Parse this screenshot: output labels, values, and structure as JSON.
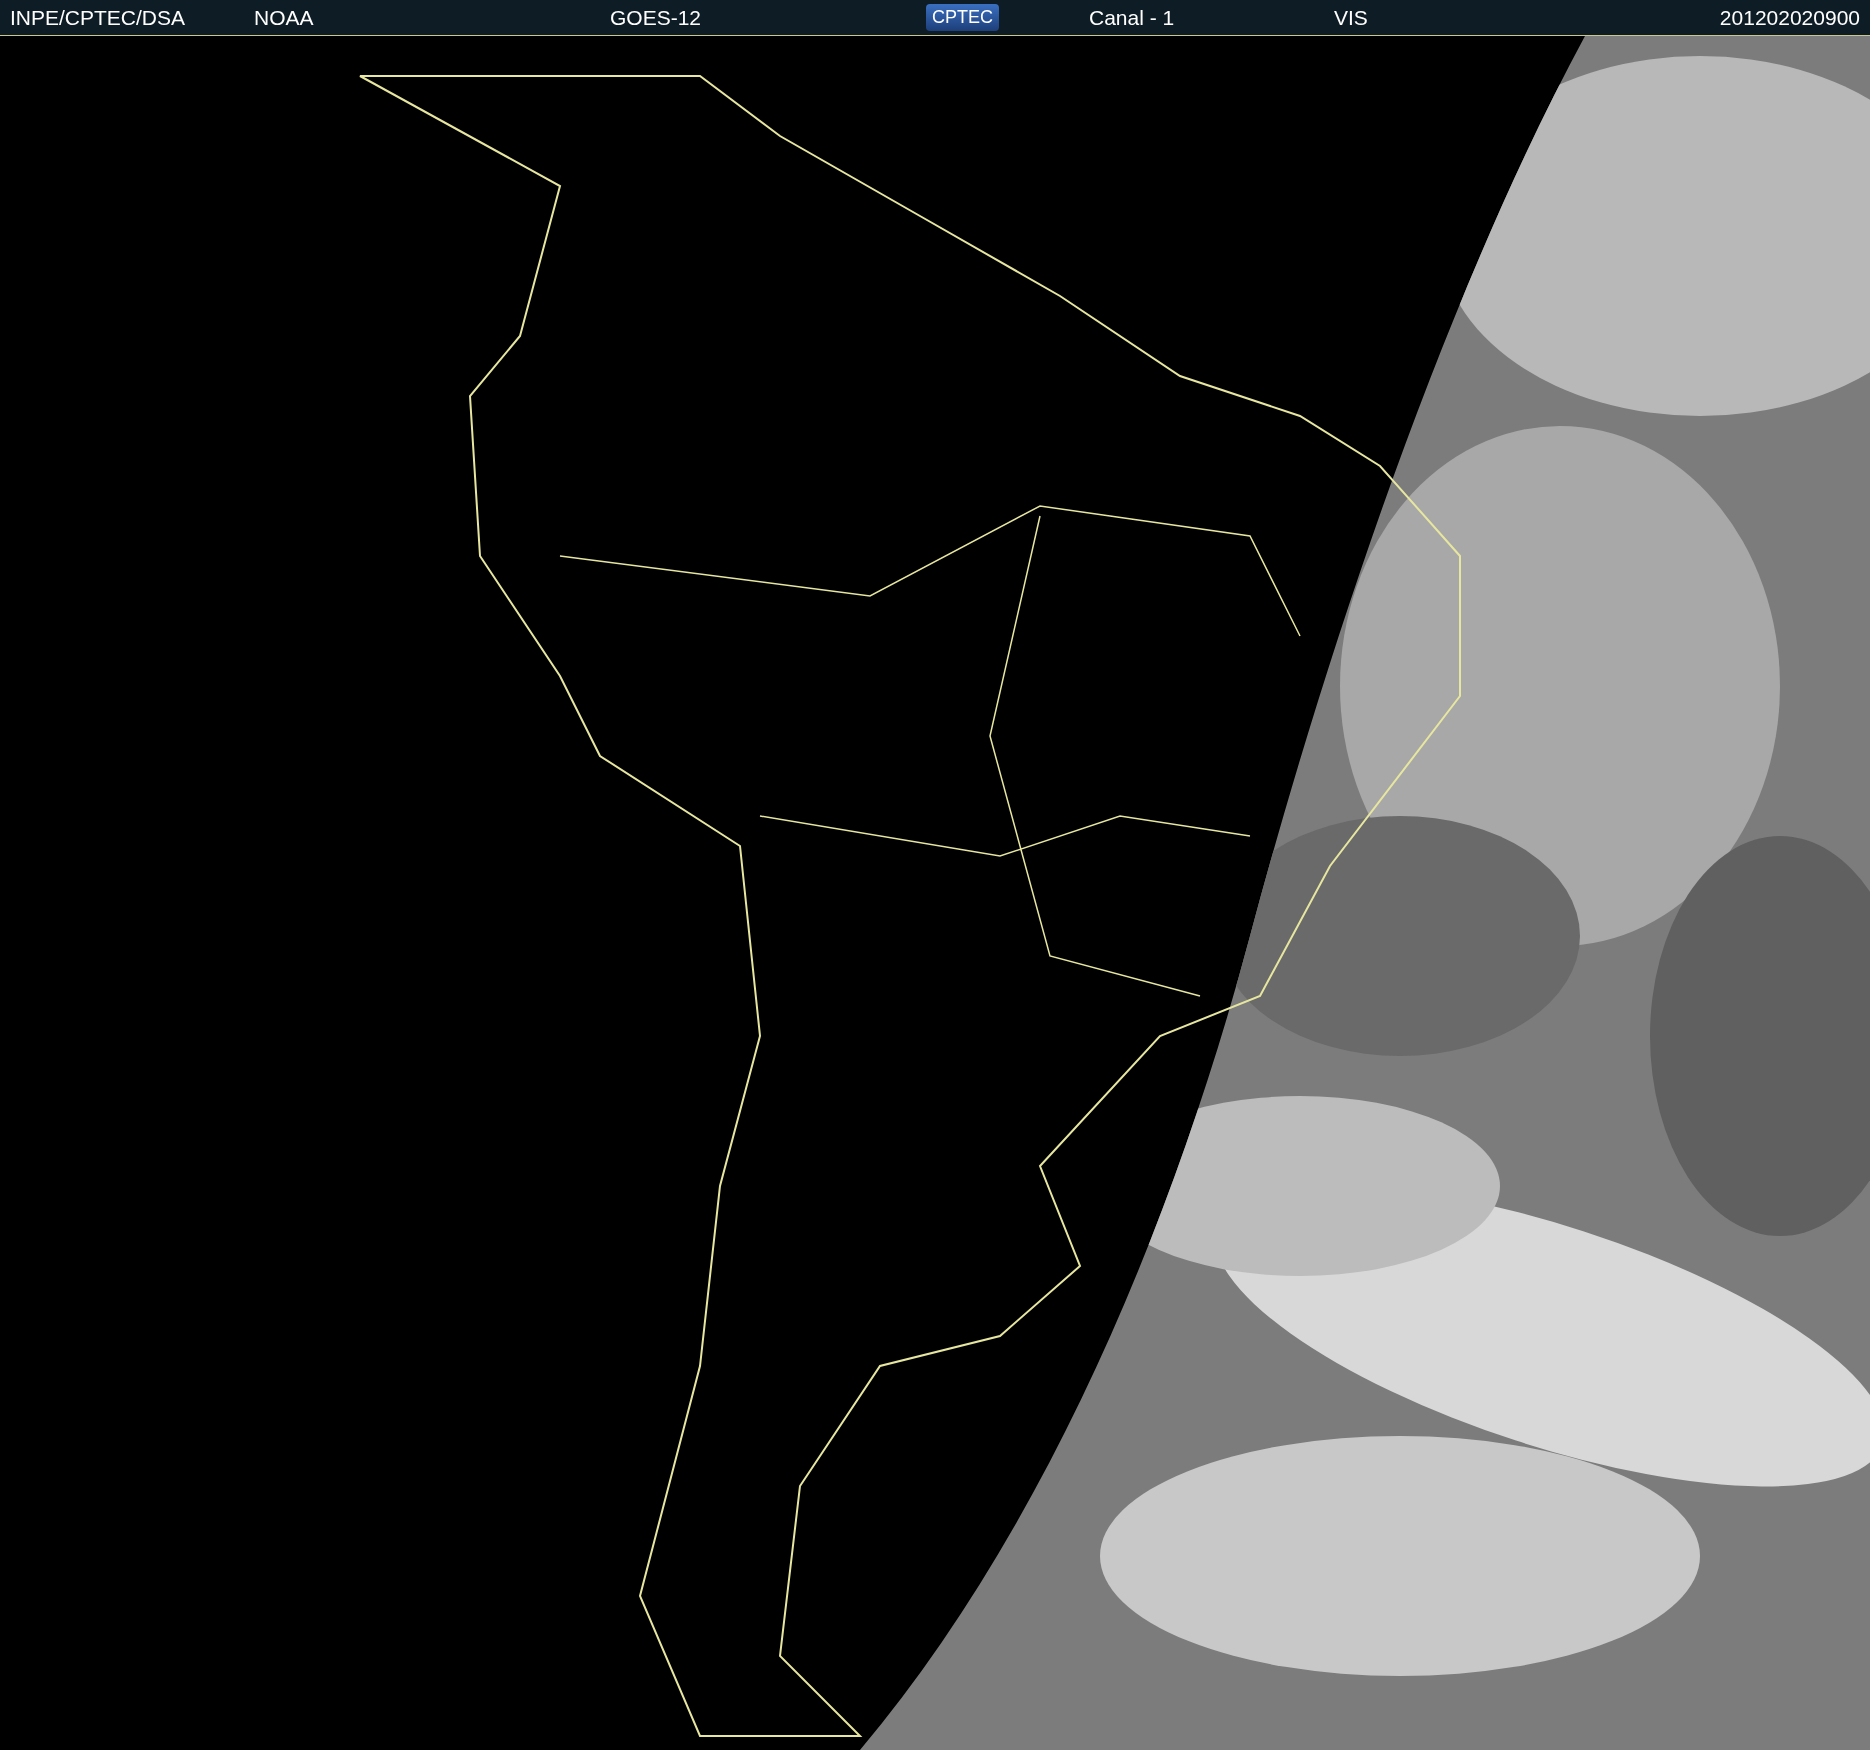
{
  "header": {
    "items": [
      {
        "kind": "text",
        "text": "INPE/CPTEC/DSA"
      },
      {
        "kind": "text",
        "text": "NOAA"
      },
      {
        "kind": "text",
        "text": "GOES-12"
      },
      {
        "kind": "logo",
        "text": "CPTEC"
      },
      {
        "kind": "text",
        "text": "Canal - 1"
      },
      {
        "kind": "text",
        "text": "VIS"
      },
      {
        "kind": "text",
        "text": "201202020900"
      }
    ]
  }
}
